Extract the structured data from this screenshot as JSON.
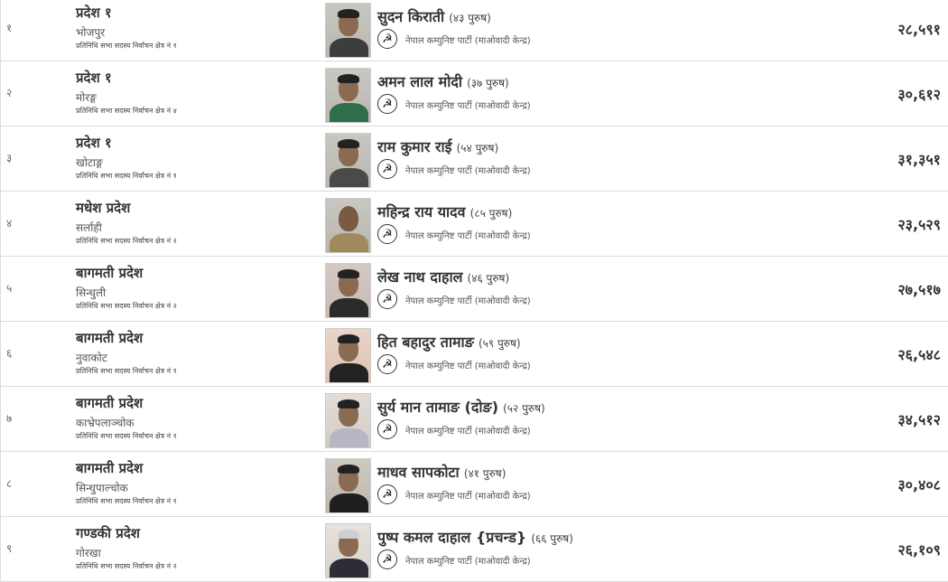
{
  "party_icon": "hammer-sickle-icon",
  "rows": [
    {
      "sn": "१",
      "province": "प्रदेश १",
      "district": "भोजपुर",
      "constituency": "प्रतिनिधि सभा सदस्य निर्वाचन क्षेत्र नं १",
      "name": "सुदन किराती",
      "age": "(४३ पुरुष)",
      "party": "नेपाल कम्युनिष्ट पार्टी (माओवादी केन्द्र)",
      "votes": "२८,५९१"
    },
    {
      "sn": "२",
      "province": "प्रदेश १",
      "district": "मोरङ्ग",
      "constituency": "प्रतिनिधि सभा सदस्य निर्वाचन क्षेत्र नं ४",
      "name": "अमन लाल मोदी",
      "age": "(३७ पुरुष)",
      "party": "नेपाल कम्युनिष्ट पार्टी (माओवादी केन्द्र)",
      "votes": "३०,६१२"
    },
    {
      "sn": "३",
      "province": "प्रदेश १",
      "district": "खोटाङ्ग",
      "constituency": "प्रतिनिधि सभा सदस्य निर्वाचन क्षेत्र नं १",
      "name": "राम कुमार राई",
      "age": "(५४ पुरुष)",
      "party": "नेपाल कम्युनिष्ट पार्टी (माओवादी केन्द्र)",
      "votes": "३१,३५१"
    },
    {
      "sn": "४",
      "province": "मधेश प्रदेश",
      "district": "सर्लाही",
      "constituency": "प्रतिनिधि सभा सदस्य निर्वाचन क्षेत्र नं २",
      "name": "महिन्द्र राय यादव",
      "age": "(८५ पुरुष)",
      "party": "नेपाल कम्युनिष्ट पार्टी (माओवादी केन्द्र)",
      "votes": "२३,५२९"
    },
    {
      "sn": "५",
      "province": "बागमती प्रदेश",
      "district": "सिन्धुली",
      "constituency": "प्रतिनिधि सभा सदस्य निर्वाचन क्षेत्र नं २",
      "name": "लेख नाथ दाहाल",
      "age": "(४६ पुरुष)",
      "party": "नेपाल कम्युनिष्ट पार्टी (माओवादी केन्द्र)",
      "votes": "२७,५१७"
    },
    {
      "sn": "६",
      "province": "बागमती प्रदेश",
      "district": "नुवाकोट",
      "constituency": "प्रतिनिधि सभा सदस्य निर्वाचन क्षेत्र नं १",
      "name": "हित बहादुर तामाङ",
      "age": "(५९ पुरुष)",
      "party": "नेपाल कम्युनिष्ट पार्टी (माओवादी केन्द्र)",
      "votes": "२६,५४८"
    },
    {
      "sn": "७",
      "province": "बागमती प्रदेश",
      "district": "काभ्रेपलाञ्चोक",
      "constituency": "प्रतिनिधि सभा सदस्य निर्वाचन क्षेत्र नं १",
      "name": "सुर्य मान तामाङ (दोङ)",
      "age": "(५२ पुरुष)",
      "party": "नेपाल कम्युनिष्ट पार्टी (माओवादी केन्द्र)",
      "votes": "३४,५१२"
    },
    {
      "sn": "८",
      "province": "बागमती प्रदेश",
      "district": "सिन्धुपाल्चोक",
      "constituency": "प्रतिनिधि सभा सदस्य निर्वाचन क्षेत्र नं १",
      "name": "माधव सापकोटा",
      "age": "(४१ पुरुष)",
      "party": "नेपाल कम्युनिष्ट पार्टी (माओवादी केन्द्र)",
      "votes": "३०,४०८"
    },
    {
      "sn": "९",
      "province": "गण्डकी प्रदेश",
      "district": "गोरखा",
      "constituency": "प्रतिनिधि सभा सदस्य निर्वाचन क्षेत्र नं २",
      "name": "पुष्प कमल दाहाल {प्रचन्ड}",
      "age": "(६६ पुरुष)",
      "party": "नेपाल कम्युनिष्ट पार्टी (माओवादी केन्द्र)",
      "votes": "२६,१०९"
    }
  ]
}
